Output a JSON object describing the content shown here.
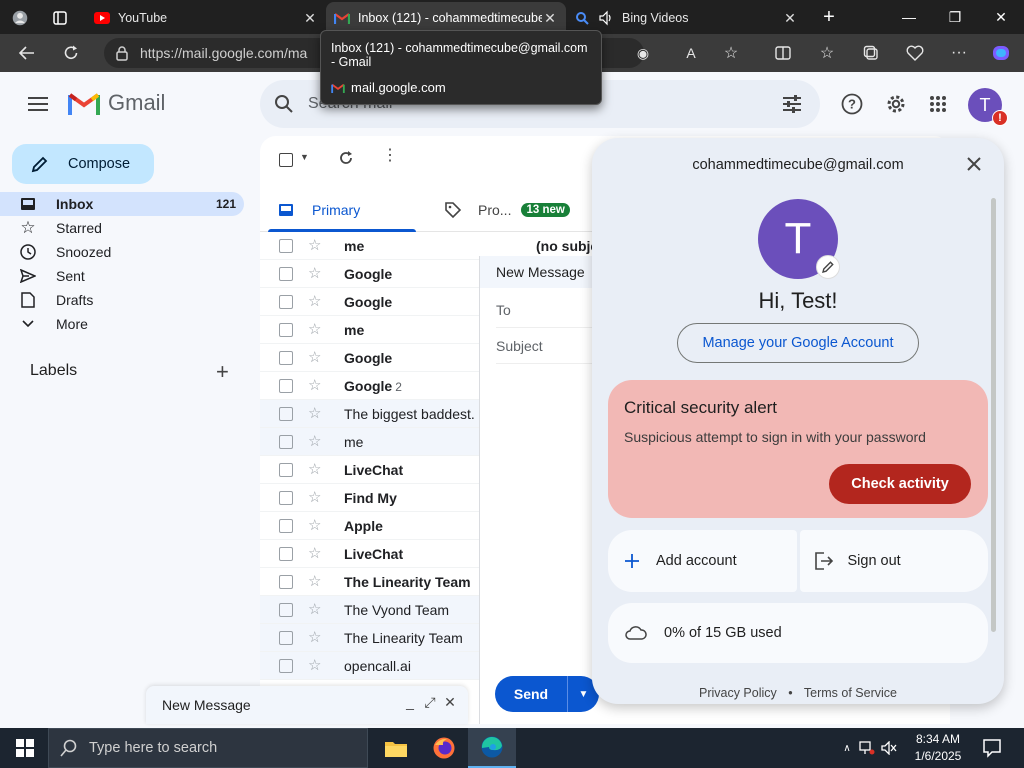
{
  "browser": {
    "tabs": [
      {
        "title": "",
        "kind": "profile"
      },
      {
        "title": "YouTube",
        "icon": "youtube-icon"
      },
      {
        "title": "Inbox (121) - cohammedtimecube@gmail.com - Gmail",
        "icon": "gmail-icon",
        "active": true
      },
      {
        "title": "Bing Videos",
        "icon": "bing-icon"
      }
    ],
    "url": "https://mail.google.com/ma",
    "tooltip": {
      "title": "Inbox (121) - cohammedtimecube@gmail.com - Gmail",
      "domain": "mail.google.com"
    }
  },
  "gmail": {
    "logo_text": "Gmail",
    "search_placeholder": "Search mail",
    "compose_label": "Compose",
    "nav": [
      {
        "label": "Inbox",
        "count": "121",
        "icon": "inbox-icon",
        "active": true
      },
      {
        "label": "Starred",
        "count": "",
        "icon": "star-icon"
      },
      {
        "label": "Snoozed",
        "count": "",
        "icon": "clock-icon"
      },
      {
        "label": "Sent",
        "count": "",
        "icon": "send-icon"
      },
      {
        "label": "Drafts",
        "count": "",
        "icon": "draft-icon"
      },
      {
        "label": "More",
        "count": "",
        "icon": "chevron-down-icon"
      }
    ],
    "labels_heading": "Labels",
    "avatar_letter": "T",
    "avatar_alert": "!",
    "tabs": [
      {
        "label": "Primary",
        "active": true
      },
      {
        "label": "Pro...",
        "badge": "13 new"
      }
    ],
    "rows": [
      {
        "sender": "me",
        "count": "",
        "unread": true,
        "subject": "(no subject)"
      },
      {
        "sender": "Google",
        "count": "",
        "unread": true
      },
      {
        "sender": "Google",
        "count": "",
        "unread": true
      },
      {
        "sender": "me",
        "count": "",
        "unread": true
      },
      {
        "sender": "Google",
        "count": "",
        "unread": true
      },
      {
        "sender": "Google",
        "count": "2",
        "unread": true
      },
      {
        "sender": "The biggest baddest.",
        "count": "",
        "unread": false
      },
      {
        "sender": "me",
        "count": "",
        "unread": false
      },
      {
        "sender": "LiveChat",
        "count": "",
        "unread": true
      },
      {
        "sender": "Find My",
        "count": "",
        "unread": true
      },
      {
        "sender": "Apple",
        "count": "",
        "unread": true
      },
      {
        "sender": "LiveChat",
        "count": "",
        "unread": true
      },
      {
        "sender": "The Linearity Team",
        "count": "",
        "unread": true
      },
      {
        "sender": "The Vyond Team",
        "count": "",
        "unread": false
      },
      {
        "sender": "The Linearity Team",
        "count": "",
        "unread": false
      },
      {
        "sender": "opencall.ai",
        "count": "",
        "unread": false
      }
    ],
    "compose_window": {
      "title": "New Message",
      "to_label": "To",
      "subject_label": "Subject",
      "send_label": "Send"
    },
    "minimized_window": {
      "title": "New Message"
    }
  },
  "account": {
    "email": "cohammedtimecube@gmail.com",
    "avatar_letter": "T",
    "greeting": "Hi, Test!",
    "manage_label": "Manage your Google Account",
    "alert": {
      "title": "Critical security alert",
      "description": "Suspicious attempt to sign in with your password",
      "button": "Check activity"
    },
    "add_account": "Add account",
    "sign_out": "Sign out",
    "storage": "0% of 15 GB used",
    "privacy": "Privacy Policy",
    "separator": "•",
    "terms": "Terms of Service"
  },
  "taskbar": {
    "search_placeholder": "Type here to search",
    "time": "8:34 AM",
    "date": "1/6/2025"
  }
}
